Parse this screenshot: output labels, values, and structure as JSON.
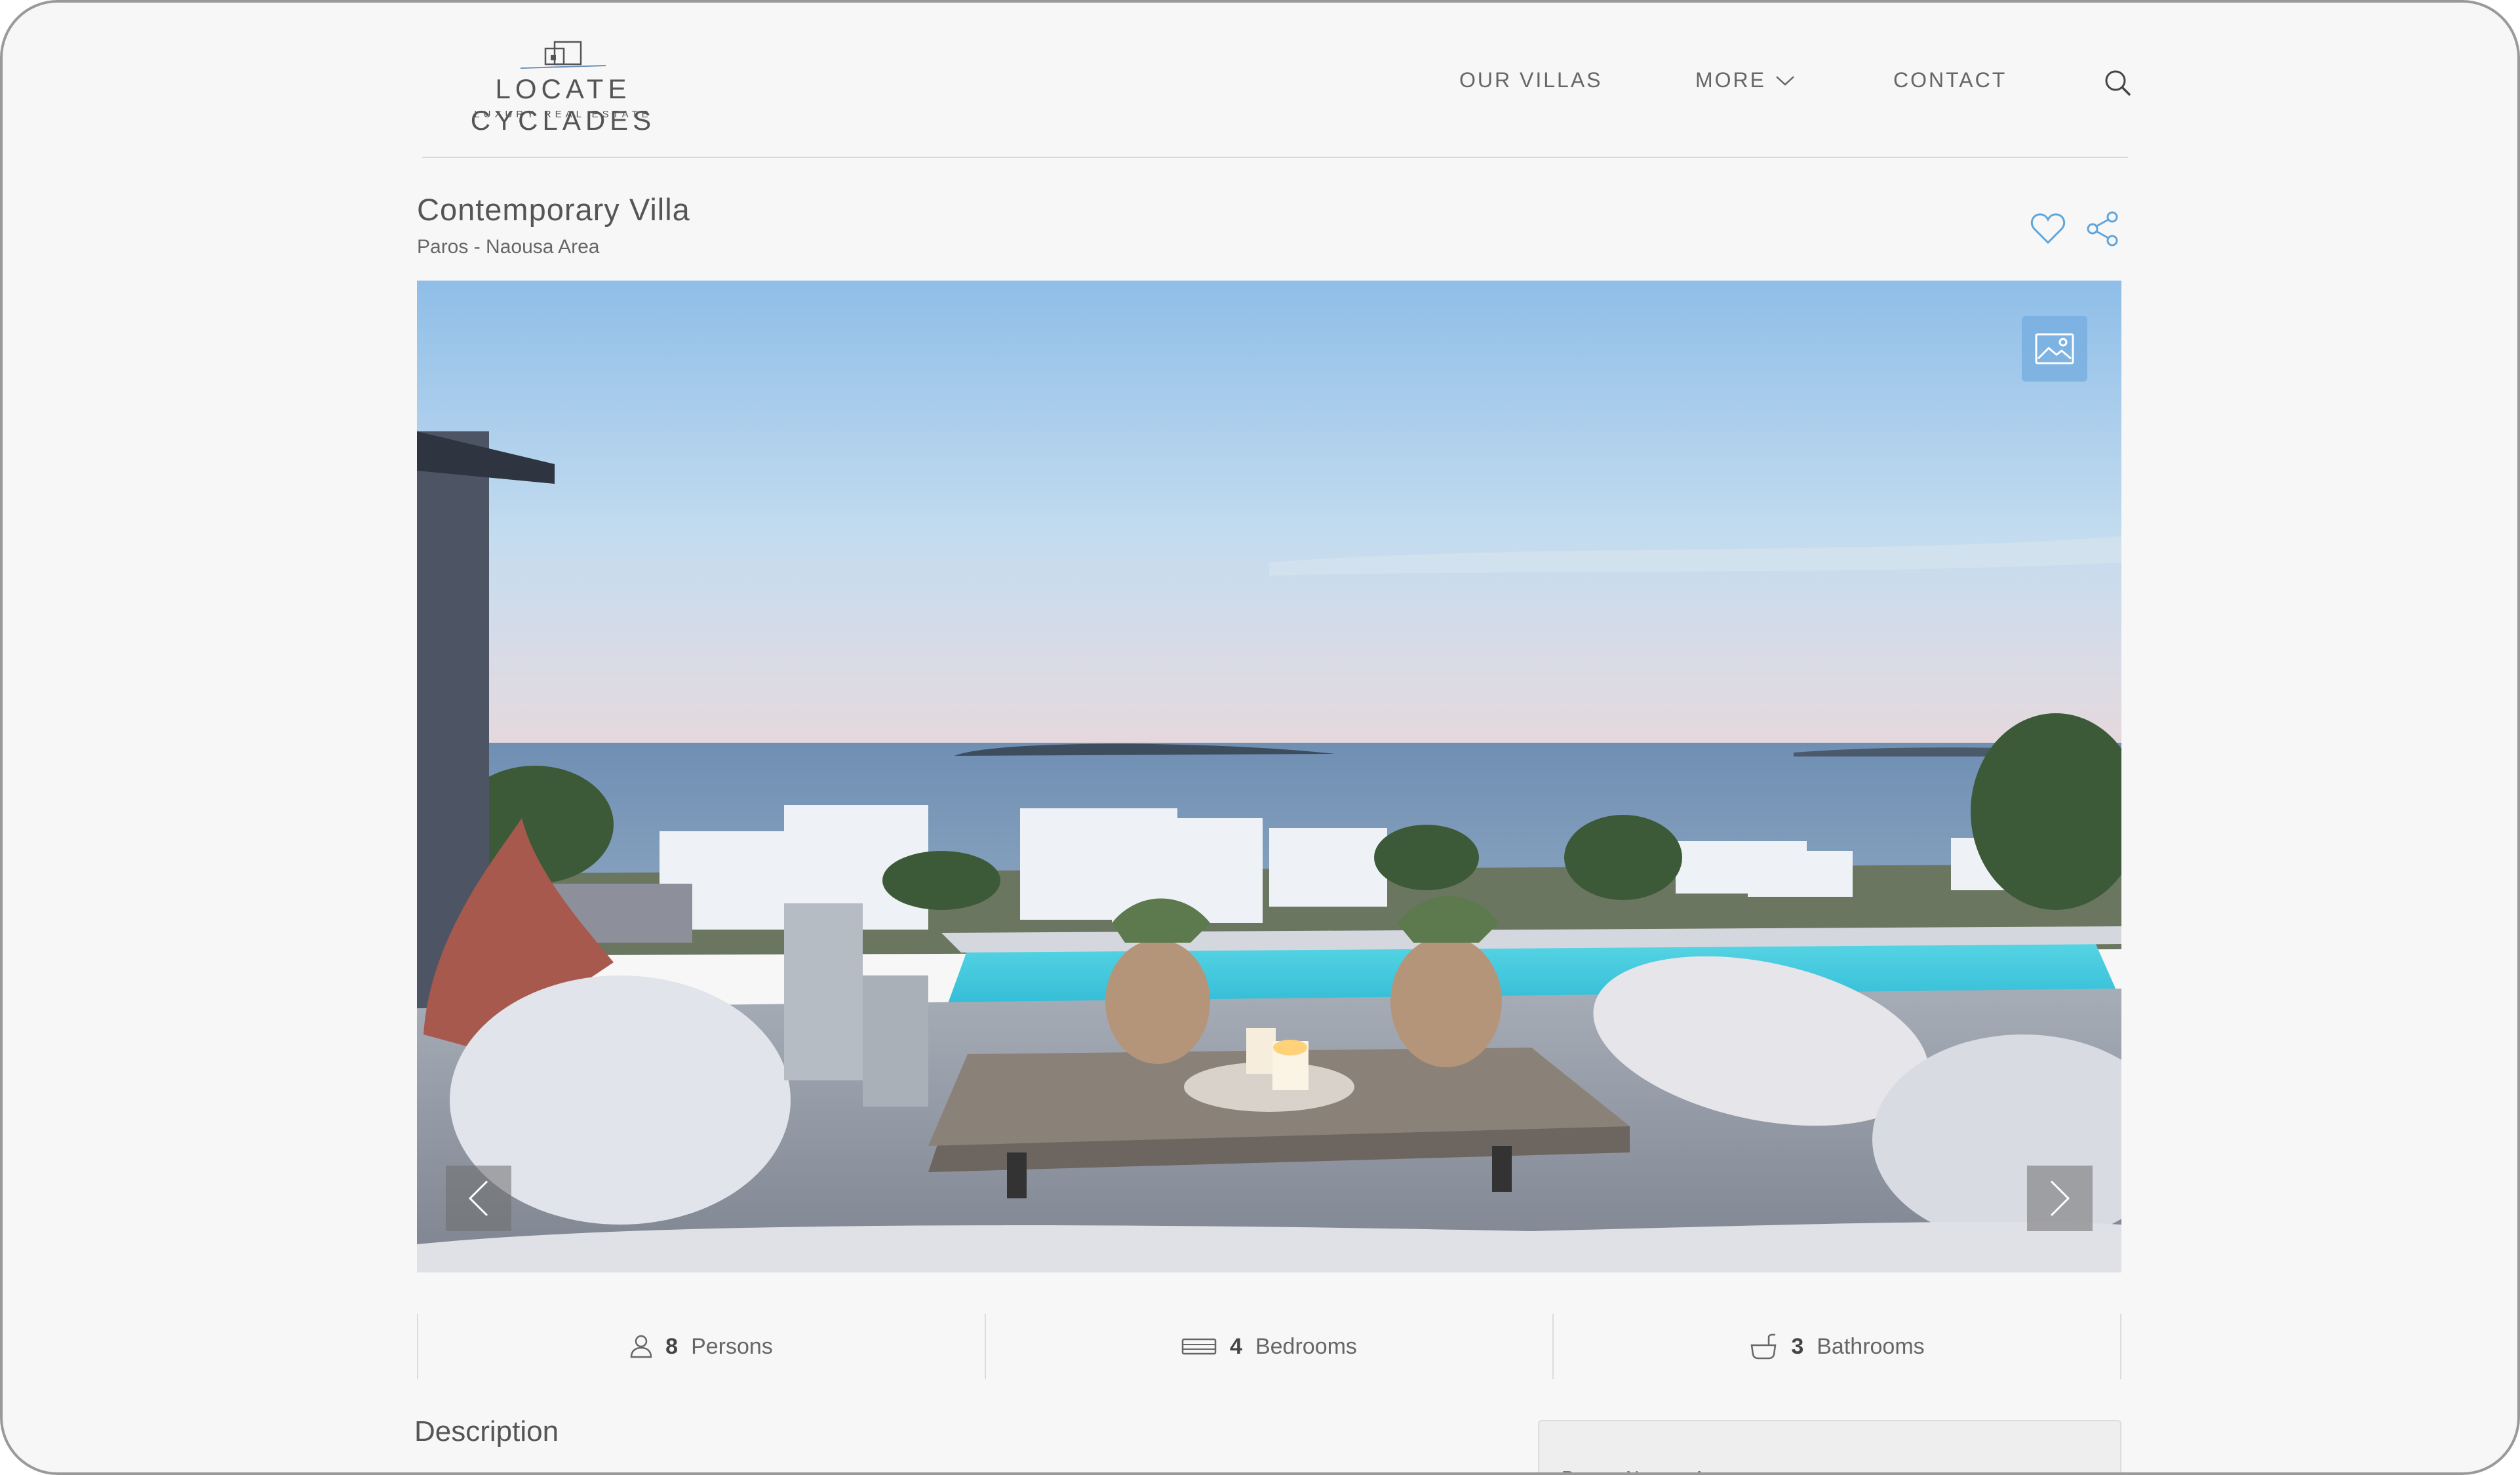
{
  "header": {
    "logo_title": "LOCATE CYCLADES",
    "logo_subtitle": "LUXURY REAL ESTATE",
    "nav": [
      {
        "label": "OUR  VILLAS"
      },
      {
        "label": "MORE"
      },
      {
        "label": "CONTACT"
      }
    ],
    "icons": [
      "search-icon",
      "chevron-down-icon"
    ]
  },
  "listing": {
    "title": "Contemporary Villa",
    "location": "Paros - Naousa Area",
    "actions": [
      "heart-icon",
      "share-icon"
    ]
  },
  "gallery": {
    "controls": [
      "gallery-icon",
      "chevron-left-icon",
      "chevron-right-icon"
    ]
  },
  "stats": [
    {
      "icon": "person-icon",
      "value": "8",
      "label": "Persons"
    },
    {
      "icon": "bed-icon",
      "value": "4",
      "label": "Bedrooms"
    },
    {
      "icon": "bathtub-icon",
      "value": "3",
      "label": "Bathrooms"
    }
  ],
  "description": {
    "heading": "Description",
    "side_location": "Paros - Naousa Area"
  },
  "colors": {
    "accent": "#5fa6dc",
    "background": "#f7f7f7",
    "text": "#555555"
  }
}
